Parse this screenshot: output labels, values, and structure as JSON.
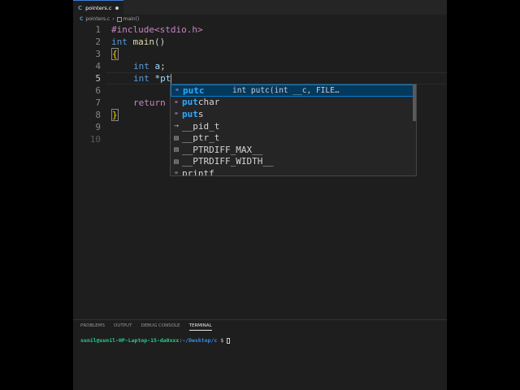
{
  "tab": {
    "icon": "C",
    "label": "pointers.c"
  },
  "breadcrumb": {
    "file_icon": "C",
    "file": "pointers.c",
    "separator": "›",
    "symbol": "main()"
  },
  "code": {
    "line_numbers": [
      "1",
      "2",
      "3",
      "4",
      "5",
      "6",
      "7",
      "8",
      "9",
      "10"
    ],
    "l1": "#include<stdio.h>",
    "l2_kw": "int",
    "l2_fn": "main",
    "l2_rest": "()",
    "l3": "{",
    "l4_kw": "int",
    "l4_var": "a",
    "l4_rest": ";",
    "l5_kw": "int",
    "l5_rest": "*pt",
    "l7_kw": "return",
    "l8": "}"
  },
  "suggest": {
    "items": [
      {
        "label_hl": "putc",
        "label_rest": "",
        "detail": "int putc(int __c, FILE…",
        "icon": "cube-icon"
      },
      {
        "label_hl": "put",
        "label_rest": "char",
        "detail": "",
        "icon": "cube-icon"
      },
      {
        "label_hl": "put",
        "label_rest": "s",
        "detail": "",
        "icon": "cube-icon"
      },
      {
        "label_hl": "",
        "label_rest": "__pid_t",
        "detail": "",
        "icon": "typedef-icon"
      },
      {
        "label_hl": "",
        "label_rest": "__ptr_t",
        "detail": "",
        "icon": "field-icon"
      },
      {
        "label_hl": "",
        "label_rest": "__PTRDIFF_MAX__",
        "detail": "",
        "icon": "field-icon"
      },
      {
        "label_hl": "",
        "label_rest": "__PTRDIFF_WIDTH__",
        "detail": "",
        "icon": "field-icon"
      },
      {
        "label_hl": "",
        "label_rest": "printf",
        "detail": "",
        "icon": "cube-icon"
      }
    ]
  },
  "panel": {
    "tabs": [
      "PROBLEMS",
      "OUTPUT",
      "DEBUG CONSOLE",
      "TERMINAL"
    ],
    "terminal_user": "sunil@sunil-HP-Laptop-15-da0xxx",
    "terminal_colon": ":",
    "terminal_path": "~/Desktop/c",
    "terminal_prompt": " $ "
  },
  "colors": {
    "accent": "#007fd4",
    "keyword": "#569cd6",
    "function": "#dcdcaa",
    "variable": "#9cdcfe",
    "preprocessor": "#c586c0"
  }
}
